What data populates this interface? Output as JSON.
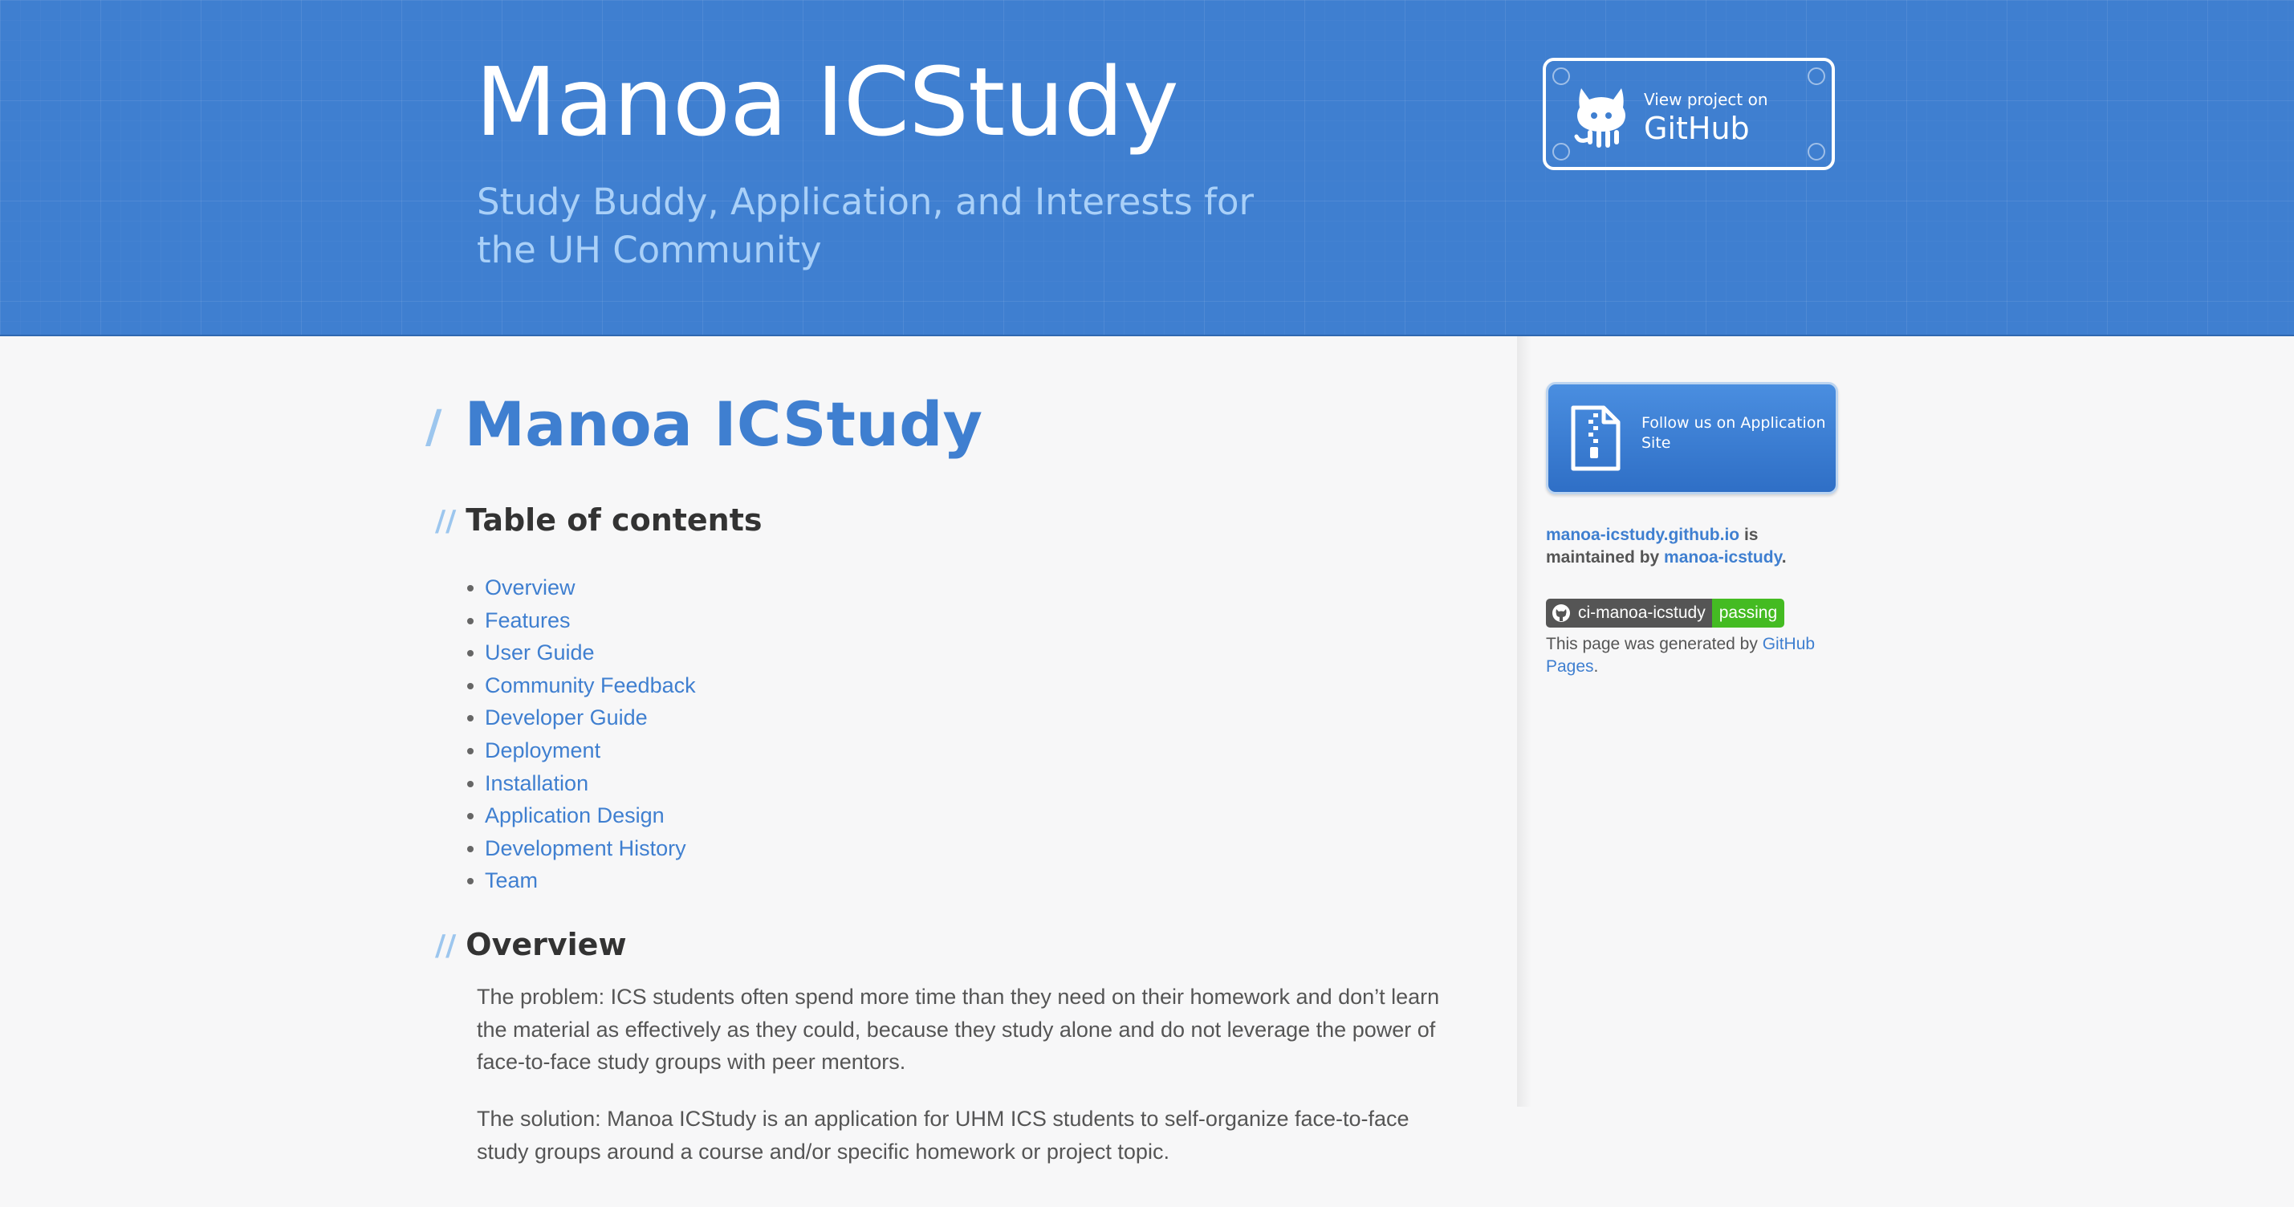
{
  "header": {
    "title": "Manoa ICStudy",
    "tagline": "Study Buddy, Application, and Interests for the UH Community",
    "github_button": {
      "small": "View project on",
      "big": "GitHub",
      "icon": "octocat-icon"
    }
  },
  "main": {
    "title": "Manoa ICStudy",
    "toc_heading": "Table of contents",
    "toc": [
      "Overview",
      "Features",
      "User Guide",
      "Community Feedback",
      "Developer Guide",
      "Deployment",
      "Installation",
      "Application Design",
      "Development History",
      "Team"
    ],
    "overview_heading": "Overview",
    "paragraphs": [
      "The problem: ICS students often spend more time than they need on their homework and don’t learn the material as effectively as they could, because they study alone and do not leverage the power of face-to-face study groups with peer mentors.",
      "The solution: Manoa ICStudy is an application for UHM ICS students to self-organize face-to-face study groups around a course and/or specific homework or project topic."
    ]
  },
  "sidebar": {
    "app_button_label": "Follow us on Application Site",
    "maintained_site": "manoa-icstudy.github.io",
    "maintained_is": "is",
    "maintained_by": "maintained by",
    "maintainer": "manoa-icstudy",
    "maintainer_dot": ".",
    "badge_left": "ci-manoa-icstudy",
    "badge_right": "passing",
    "generated_prefix": "This page was generated by",
    "generated_link": "GitHub Pages",
    "generated_suffix": "."
  },
  "colors": {
    "header_blue": "#3f7fd0",
    "link_blue": "#3f7fd0",
    "badge_green": "#44bb22"
  }
}
